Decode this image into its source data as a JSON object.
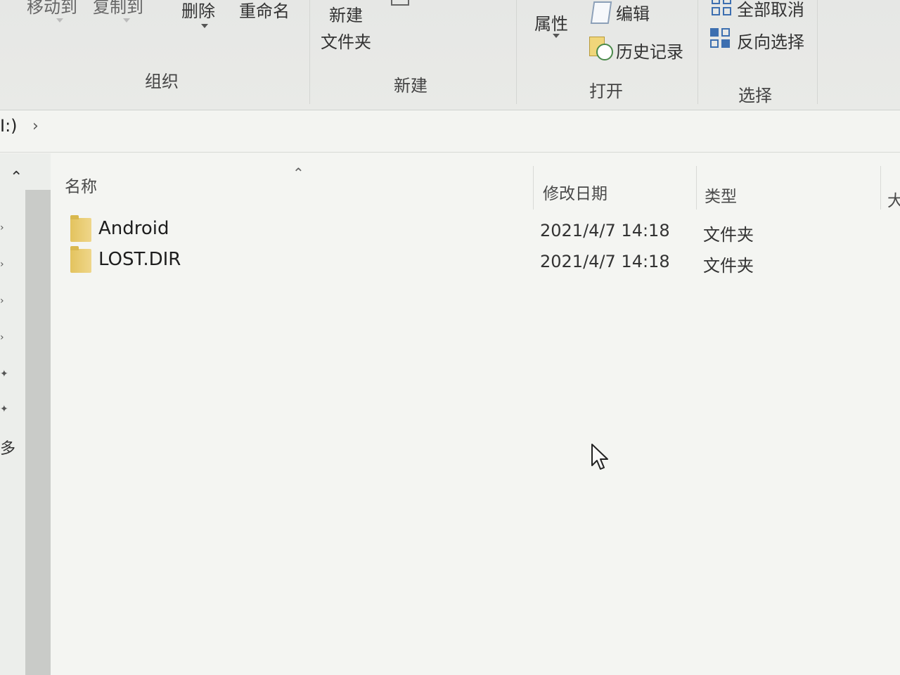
{
  "ribbon": {
    "organize": {
      "move_to": "移动到",
      "copy_to": "复制到",
      "delete": "删除",
      "rename": "重命名",
      "group_label": "组织"
    },
    "new": {
      "new_folder_line1": "新建",
      "new_folder_line2": "文件夹",
      "group_label": "新建"
    },
    "open": {
      "properties": "属性",
      "edit": "编辑",
      "history": "历史记录",
      "group_label": "打开"
    },
    "select": {
      "select_none": "全部取消",
      "invert_selection": "反向选择",
      "group_label": "选择"
    }
  },
  "address": {
    "path": "I:)",
    "separator": "›"
  },
  "columns": {
    "name": "名称",
    "modified": "修改日期",
    "type": "类型",
    "size": "大"
  },
  "files": [
    {
      "name": "Android",
      "modified": "2021/4/7 14:18",
      "type": "文件夹"
    },
    {
      "name": "LOST.DIR",
      "modified": "2021/4/7 14:18",
      "type": "文件夹"
    }
  ],
  "nav": {
    "partial_label": "多"
  },
  "icons": [
    "edit-icon",
    "history-icon",
    "select-none-icon",
    "invert-selection-icon",
    "folder-icon",
    "chevron-up-icon",
    "pin-icon",
    "mouse-cursor-icon"
  ]
}
